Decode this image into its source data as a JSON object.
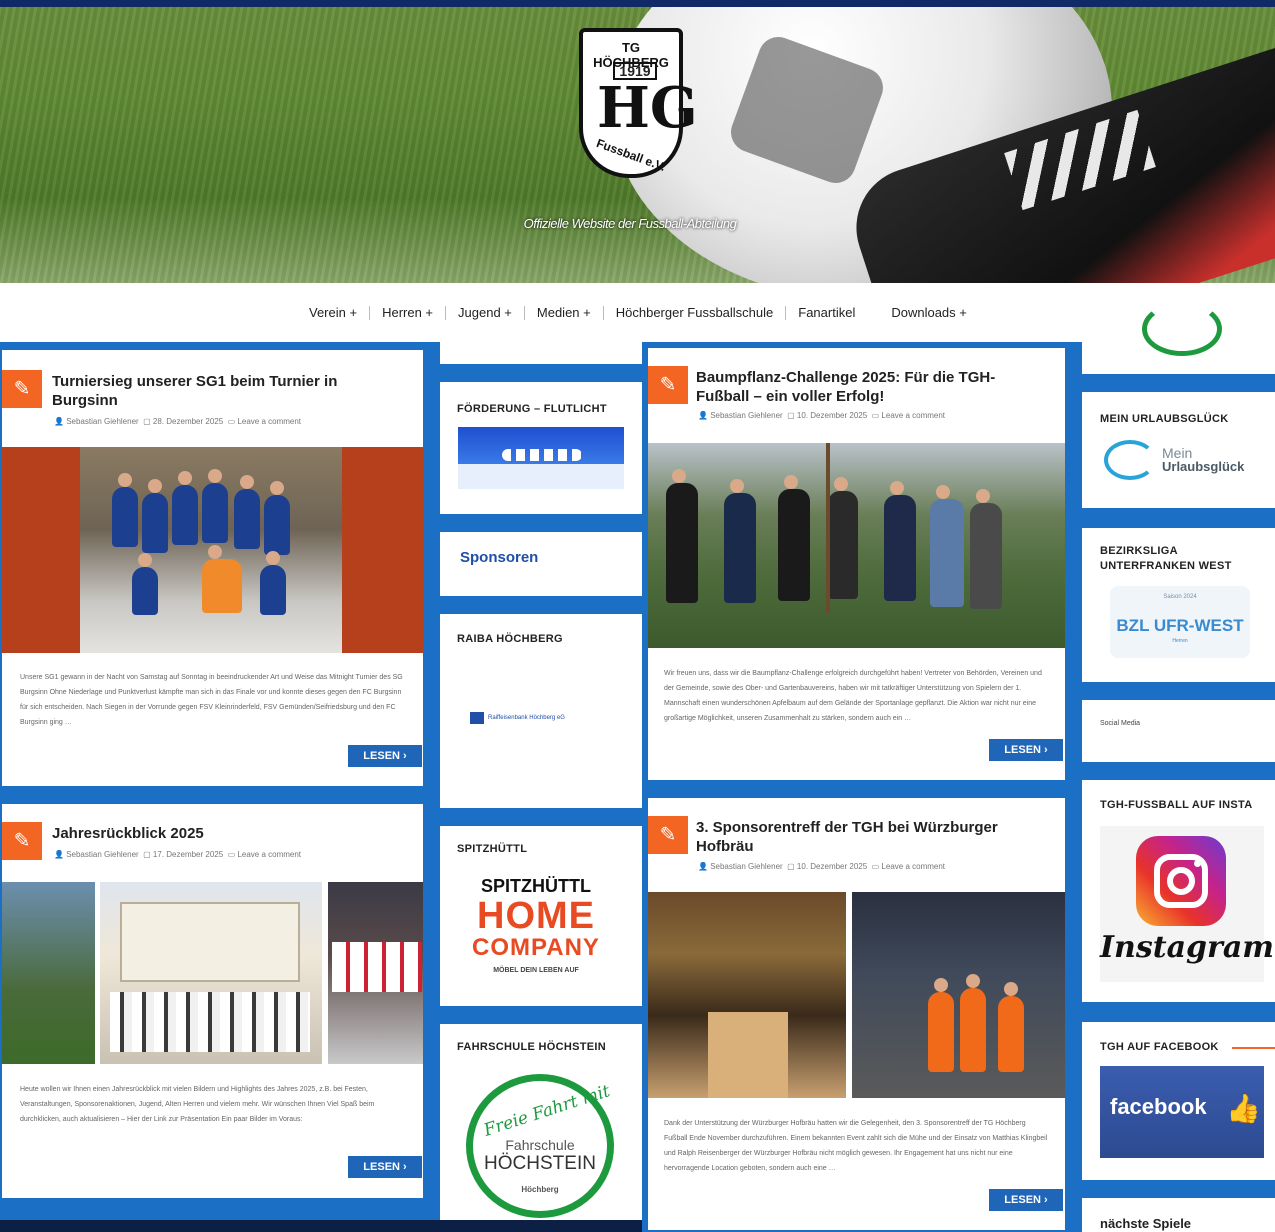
{
  "header": {
    "logo_text_top": "TG HÖCHBERG",
    "logo_year": "1919",
    "logo_monogram": "HG",
    "logo_text_bottom": "Fussball e.V.",
    "tagline": "Offizielle Website der Fussball-Abteilung"
  },
  "nav": {
    "items": [
      "Verein +",
      "Herren +",
      "Jugend +",
      "Medien +",
      "Höchberger Fussballschule",
      "Fanartikel",
      "Downloads +"
    ]
  },
  "posts": [
    {
      "title": "Turniersieg unserer SG1 beim Turnier in Burgsinn",
      "author": "Sebastian Giehlener",
      "date": "28. Dezember 2025",
      "comments": "Leave a comment",
      "excerpt": "Unsere SG1 gewann in der Nacht von Samstag auf Sonntag in beeindruckender Art und Weise das Mitnight Turnier des SG Burgsinn Ohne Niederlage und Punktverlust kämpfte man sich in das Finale vor und konnte dieses gegen den FC Burgsinn für sich entscheiden. Nach Siegen in der Vorrunde gegen FSV Kleinrinderfeld, FSV Gemünden/Seifriedsburg und den FC Burgsinn ging …",
      "button": "LESEN ›"
    },
    {
      "title": "Jahresrückblick 2025",
      "author": "Sebastian Giehlener",
      "date": "17. Dezember 2025",
      "comments": "Leave a comment",
      "excerpt": "Heute wollen wir Ihnen einen Jahresrückblick mit vielen Bildern und Highlights des Jahres 2025, z.B. bei Festen, Veranstaltungen, Sponsorenaktionen, Jugend, Alten Herren und vielem mehr. Wir wünschen Ihnen Viel Spaß beim durchklicken, auch aktualisieren – Hier der Link zur Präsentation Ein paar Bilder im Voraus:",
      "button": "LESEN ›"
    },
    {
      "title": "Baumpflanz-Challenge 2025: Für die TGH-Fußball – ein voller Erfolg!",
      "author": "Sebastian Giehlener",
      "date": "10. Dezember 2025",
      "comments": "Leave a comment",
      "excerpt": "Wir freuen uns, dass wir die Baumpflanz-Challenge erfolgreich durchgeführt haben! Vertreter von Behörden, Vereinen und der Gemeinde, sowie des Ober- und Gartenbauvereins, haben wir mit tatkräftiger Unterstützung von Spielern der 1. Mannschaft einen wunderschönen Apfelbaum auf dem Gelände der Sportanlage gepflanzt. Die Aktion war nicht nur eine großartige Möglichkeit, unseren Zusammenhalt zu stärken, sondern auch ein …",
      "button": "LESEN ›"
    },
    {
      "title": "3. Sponsorentreff der TGH bei Würzburger Hofbräu",
      "author": "Sebastian Giehlener",
      "date": "10. Dezember 2025",
      "comments": "Leave a comment",
      "excerpt": "Dank der Unterstützung der Würzburger Hofbräu hatten wir die Gelegenheit, den 3. Sponsorentreff der TG Höchberg Fußball Ende November durchzuführen. Einem bekannten Event zahlt sich die Mühe und der Einsatz von Matthias Klingbeil und Ralph Reisenberger der Würzburger Hofbräu nicht möglich gewesen. Ihr Engagement hat uns nicht nur eine hervorragende Location geboten, sondern auch eine …",
      "button": "LESEN ›"
    }
  ],
  "sidebar_mid": {
    "foerderung_title": "FÖRDERUNG – FLUTLICHT",
    "sponsoren_link": "Sponsoren",
    "raiba_title": "RAIBA HÖCHBERG",
    "raiba_logo_text": "Raiffeisenbank Höchberg eG",
    "spitzhuettl_title": "SPITZHÜTTL",
    "spitzhuettl_logo": {
      "top": "SPITZHÜTTL",
      "line1": "HOME",
      "line2": "COMPANY",
      "sub": "MÖBEL DEIN LEBEN AUF"
    },
    "fahrschule_title": "FAHRSCHULE HÖCHSTEIN",
    "fahrschule_logo": {
      "script": "Freie Fahrt mit",
      "name1": "Fahrschule",
      "name2": "HÖCHSTEIN",
      "place": "Höchberg"
    }
  },
  "sidebar_right": {
    "urlaub_title": "MEIN URLAUBSGLÜCK",
    "urlaub_logo": {
      "line1": "Mein",
      "line2": "Urlaubsglück"
    },
    "bzl_title": "BEZIRKSLIGA UNTERFRANKEN WEST",
    "bzl_logo": {
      "small": "Saison 2024",
      "main": "BZL UFR-WEST",
      "sub": "Herren"
    },
    "social_link": "Social Media",
    "insta_title": "TGH-FUSSBALL AUF INSTA",
    "insta_word": "Instagram",
    "facebook_title": "TGH AUF FACEBOOK",
    "facebook_word": "facebook",
    "next_games_title": "nächste Spiele"
  },
  "colors": {
    "accent_orange": "#f26522",
    "brand_blue": "#1b6fc4",
    "button_blue": "#1f66b8",
    "dark_navy": "#0f2a66"
  }
}
